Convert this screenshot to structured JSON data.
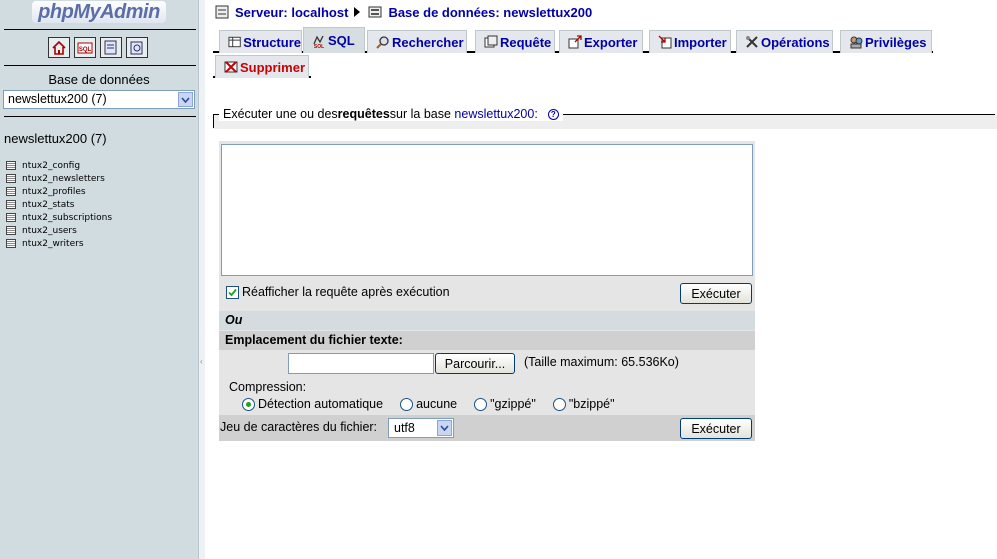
{
  "left": {
    "logo": {
      "php": "php",
      "myadmin": "MyAdmin"
    },
    "icons": [
      "home-icon",
      "sql-icon",
      "query-window-icon",
      "docs-icon"
    ],
    "db_label": "Base de données",
    "db_select": "newslettux200 (7)",
    "db_name": "newslettux200 (7)",
    "tables": [
      "ntux2_config",
      "ntux2_newsletters",
      "ntux2_profiles",
      "ntux2_stats",
      "ntux2_subscriptions",
      "ntux2_users",
      "ntux2_writers"
    ]
  },
  "breadcrumb": {
    "server": "Serveur: localhost",
    "database": "Base de données: newslettux200"
  },
  "tabs": [
    {
      "label": "Structure",
      "icon": "structure-icon"
    },
    {
      "label": "SQL",
      "icon": "sql-icon",
      "active": true
    },
    {
      "label": "Rechercher",
      "icon": "search-icon"
    },
    {
      "label": "Requête",
      "icon": "query-icon"
    },
    {
      "label": "Exporter",
      "icon": "export-icon"
    },
    {
      "label": "Importer",
      "icon": "import-icon"
    },
    {
      "label": "Opérations",
      "icon": "operations-icon"
    },
    {
      "label": "Privilèges",
      "icon": "privileges-icon"
    },
    {
      "label": "Supprimer",
      "icon": "drop-icon"
    }
  ],
  "query": {
    "legend_pre": "Exécuter une ou des ",
    "legend_bold": "requêtes",
    "legend_mid": " sur la base ",
    "legend_db": "newslettux200:",
    "sql_text": "",
    "reshow_label": "Réafficher la requête après exécution",
    "reshow_checked": true,
    "execute_label": "Exécuter"
  },
  "import": {
    "or_label": "Ou",
    "file_label": "Emplacement du fichier texte:",
    "browse_label": "Parcourir...",
    "max_size": "(Taille maximum: 65.536Ko)",
    "compression_label": "Compression:",
    "compression_options": [
      "Détection automatique",
      "aucune",
      "\"gzippé\"",
      "\"bzippé\""
    ],
    "compression_selected": "Détection automatique",
    "charset_label": "Jeu de caractères du fichier:",
    "charset_value": "utf8",
    "execute_label": "Exécuter"
  },
  "colors": {
    "link": "#0000a8",
    "left_bg": "#d0dce0",
    "drop_tab": "#cc0000"
  }
}
